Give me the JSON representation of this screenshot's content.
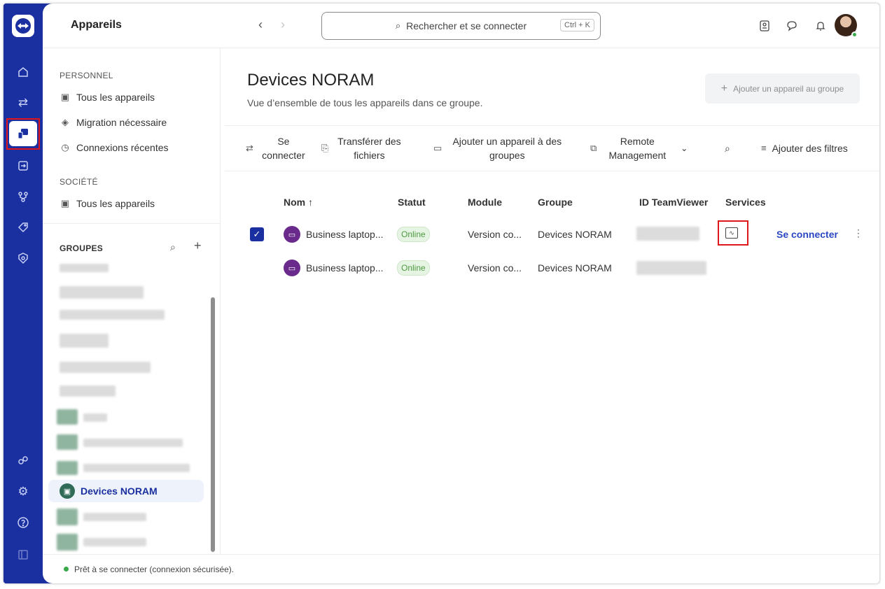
{
  "app": {
    "title": "Appareils"
  },
  "search": {
    "placeholder": "Rechercher et se connecter",
    "shortcut": "Ctrl + K"
  },
  "rail": {
    "items": [
      "home-icon",
      "transfer-icon",
      "devices-icon",
      "connections-icon",
      "integrations-icon",
      "tag-icon",
      "security-icon",
      "users-icon",
      "settings-icon",
      "help-icon",
      "collapse-icon"
    ]
  },
  "sidebar": {
    "personal_label": "PERSONNEL",
    "personal_items": [
      "Tous les appareils",
      "Migration nécessaire",
      "Connexions récentes"
    ],
    "company_label": "SOCIÉTÉ",
    "company_items": [
      "Tous les appareils"
    ],
    "groups_label": "GROUPES",
    "selected_group": "Devices NORAM"
  },
  "main": {
    "title": "Devices NORAM",
    "subtitle": "Vue d’ensemble de tous les appareils dans ce groupe.",
    "add_device_button": "Ajouter un appareil au groupe"
  },
  "toolbar": {
    "connect": "Se connecter",
    "transfer": "Transférer des fichiers",
    "add_to_groups": "Ajouter un appareil à des groupes",
    "remote_management": "Remote Management",
    "add_filters": "Ajouter des filtres"
  },
  "table": {
    "headers": [
      "Nom ↑",
      "Statut",
      "Module",
      "Groupe",
      "ID TeamViewer",
      "Services"
    ],
    "rows": [
      {
        "name": "Business laptop...",
        "status": "Online",
        "module": "Version co...",
        "group": "Devices NORAM",
        "connect": "Se connecter"
      },
      {
        "name": "Business laptop...",
        "status": "Online",
        "module": "Version co...",
        "group": "Devices NORAM"
      }
    ]
  },
  "footer": {
    "status": "Prêt à se connecter (connexion sécurisée)."
  },
  "colors": {
    "brand": "#1a2fa0",
    "online": "#38a948",
    "highlight": "#e0161b"
  }
}
